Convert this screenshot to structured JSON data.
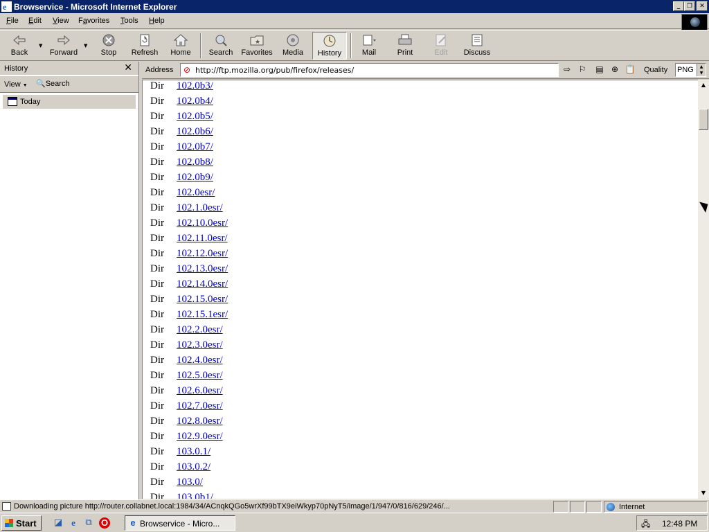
{
  "window": {
    "title": "Browservice - Microsoft Internet Explorer"
  },
  "menu": [
    {
      "label": "File",
      "u": "F"
    },
    {
      "label": "Edit",
      "u": "E"
    },
    {
      "label": "View",
      "u": "V"
    },
    {
      "label": "Favorites",
      "u": "a"
    },
    {
      "label": "Tools",
      "u": "T"
    },
    {
      "label": "Help",
      "u": "H"
    }
  ],
  "toolbar": {
    "back": "Back",
    "forward": "Forward",
    "stop": "Stop",
    "refresh": "Refresh",
    "home": "Home",
    "search": "Search",
    "favorites": "Favorites",
    "media": "Media",
    "history": "History",
    "mail": "Mail",
    "print": "Print",
    "edit": "Edit",
    "discuss": "Discuss"
  },
  "history_pane": {
    "title": "History",
    "view_label": "View",
    "search_label": "Search",
    "today_label": "Today"
  },
  "address": {
    "label": "Address",
    "url": "http://ftp.mozilla.org/pub/firefox/releases/",
    "quality_label": "Quality",
    "quality_value": "PNG"
  },
  "listing": [
    {
      "type": "Dir",
      "name": "102.0b3/"
    },
    {
      "type": "Dir",
      "name": "102.0b4/"
    },
    {
      "type": "Dir",
      "name": "102.0b5/"
    },
    {
      "type": "Dir",
      "name": "102.0b6/"
    },
    {
      "type": "Dir",
      "name": "102.0b7/"
    },
    {
      "type": "Dir",
      "name": "102.0b8/"
    },
    {
      "type": "Dir",
      "name": "102.0b9/"
    },
    {
      "type": "Dir",
      "name": "102.0esr/"
    },
    {
      "type": "Dir",
      "name": "102.1.0esr/"
    },
    {
      "type": "Dir",
      "name": "102.10.0esr/"
    },
    {
      "type": "Dir",
      "name": "102.11.0esr/"
    },
    {
      "type": "Dir",
      "name": "102.12.0esr/"
    },
    {
      "type": "Dir",
      "name": "102.13.0esr/"
    },
    {
      "type": "Dir",
      "name": "102.14.0esr/"
    },
    {
      "type": "Dir",
      "name": "102.15.0esr/"
    },
    {
      "type": "Dir",
      "name": "102.15.1esr/"
    },
    {
      "type": "Dir",
      "name": "102.2.0esr/"
    },
    {
      "type": "Dir",
      "name": "102.3.0esr/"
    },
    {
      "type": "Dir",
      "name": "102.4.0esr/"
    },
    {
      "type": "Dir",
      "name": "102.5.0esr/"
    },
    {
      "type": "Dir",
      "name": "102.6.0esr/"
    },
    {
      "type": "Dir",
      "name": "102.7.0esr/"
    },
    {
      "type": "Dir",
      "name": "102.8.0esr/"
    },
    {
      "type": "Dir",
      "name": "102.9.0esr/"
    },
    {
      "type": "Dir",
      "name": "103.0.1/"
    },
    {
      "type": "Dir",
      "name": "103.0.2/"
    },
    {
      "type": "Dir",
      "name": "103.0/"
    },
    {
      "type": "Dir",
      "name": "103.0b1/"
    }
  ],
  "status": {
    "message": "Downloading picture http://router.collabnet.local:1984/34/ACnqkQGo5wrXf99bTX9eiWkyp70pNyT5/image/1/947/0/816/629/246/...",
    "zone": "Internet"
  },
  "taskbar": {
    "start_label": "Start",
    "task_label": "Browservice - Micro...",
    "clock": "12:48 PM"
  }
}
